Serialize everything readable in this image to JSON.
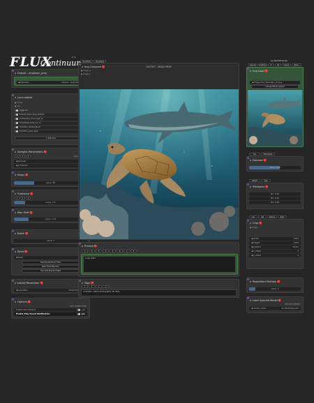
{
  "brand": {
    "logo_word": "FLUX",
    "logo_script": "Continuum",
    "version": "v1.6",
    "credit": "by WorkflowLab"
  },
  "output_preview": {
    "top_buttons": [
      "Tog Output",
      "Tog Gallery"
    ],
    "title": "Img Compare",
    "banner": "OUTPUT - MIDJ2 PREP",
    "badges": [
      "image_a",
      "image_b"
    ]
  },
  "left": {
    "output_node": {
      "title": "Output - engineer_prep",
      "field_label": "Selection",
      "field_value": "Output - engineer_prep"
    },
    "lora_loader": {
      "title": "Lora Loader",
      "rows": [
        [
          "model",
          "MODEL"
        ],
        [
          "clip",
          "CLIP"
        ]
      ],
      "header": [
        "Toggle All",
        "Strength"
      ],
      "loras": [
        [
          "FLUX/art_Black_Page_Shadow",
          "1.00"
        ],
        [
          "FLUX/Golden_Hour_Light_v1",
          "1.00"
        ],
        [
          "FLUX/Detail_Enhancer_v2",
          "1.00"
        ],
        [
          "FLUX/Skin_Texture_Boost",
          "1.00"
        ],
        [
          "FLUX/Film_Grain_Style",
          "1.00"
        ]
      ],
      "add_label": "+ Add Lora"
    },
    "sampler": {
      "title": "Sampler Parameters",
      "fields": [
        [
          "sampler",
          "euler"
        ],
        [
          "scheduler",
          "beta"
        ]
      ],
      "tabs": [
        "1",
        "2",
        "3"
      ],
      "mode": "sampler_name"
    },
    "steps": {
      "title": "Steps",
      "value": "value: 30",
      "fraction": 0.3
    },
    "guidance": {
      "title": "Guidance",
      "value": "value: 3.5",
      "tabs": [
        "1",
        "2",
        "3"
      ]
    },
    "max_shift": {
      "title": "Max Shift",
      "value": "value: 1.15"
    },
    "batch": {
      "title": "Batch",
      "value": "value: 1"
    },
    "seed": {
      "title": "Seed",
      "value": "Seed",
      "buttons": [
        "Randomize Each Time",
        "New Fixed Random",
        "Use Last Queued Seed"
      ]
    },
    "latent": {
      "title": "Latent Resolution",
      "row_label": "resolution",
      "row_value": "1024x1024 (1:1)"
    },
    "options": {
      "title": "Options",
      "tag": "OPT_CONNECTION",
      "toggles": [
        "Enable Save Output",
        "Enable Play Sound Notification"
      ],
      "toggle_value": "yes"
    }
  },
  "prompt": {
    "title": "Prompt",
    "text": "a sea turtle",
    "tabs": [
      "1",
      "2",
      "3",
      "4",
      "5",
      "6",
      "7",
      "8"
    ]
  },
  "tags": {
    "title": "Tags",
    "text": "cinematic, nature photography, 8k ultra",
    "tabs": [
      "1",
      "2",
      "3",
      "4"
    ]
  },
  "right": {
    "top_tabs": [
      "Upscale",
      "Img2Img",
      "IP",
      "CN",
      "Inpaint",
      "Redux"
    ],
    "img_load": {
      "title": "Img Load",
      "file_label": "image",
      "file": "Flux_Example_12.png",
      "upload": "choose file to upload"
    },
    "denoise": {
      "title": "Denoise",
      "value": "value: 0.60",
      "tabs": [
        "Tile",
        "Mod Cache"
      ]
    },
    "ipadapter": {
      "title": "IPAdapter",
      "tabs": [
        "Weight",
        "Type"
      ],
      "rows": [
        "IP1: 0.00",
        "IP2: 0.00",
        "IP3: 0.00"
      ]
    },
    "crop": {
      "title": "Crop",
      "tabs": [
        "Top",
        "Left",
        "Bottom",
        "Right"
      ],
      "image_label": "image",
      "rows": [
        [
          "width",
          "1024"
        ],
        [
          "height",
          "1024"
        ],
        [
          "position",
          "center"
        ],
        [
          "x_offset",
          "0"
        ],
        [
          "y_offset",
          "0"
        ]
      ]
    },
    "resolution_multiply": {
      "title": "Resolution Multiply",
      "value": "value: 2"
    },
    "load_upscale": {
      "title": "Load Upscale Model",
      "tag": "UPSCALE_MODEL",
      "row_label": "model_name",
      "row_value": "4x-UltraSharp.pth"
    }
  },
  "colors": {
    "background": "#262626",
    "node": "#333333",
    "accent_blue": "#4a6888",
    "green": "#355c37"
  }
}
